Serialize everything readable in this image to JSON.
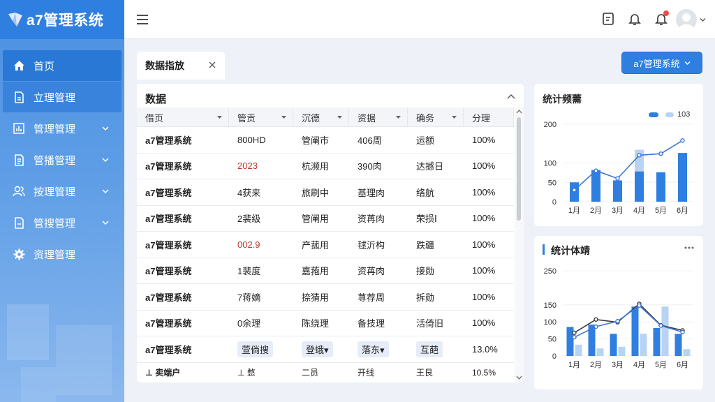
{
  "app": {
    "title": "a7管理系统"
  },
  "sidebar": {
    "items": [
      {
        "label": "首页",
        "icon": "home-icon",
        "expandable": false
      },
      {
        "label": "立理管理",
        "icon": "document-icon",
        "expandable": false
      },
      {
        "label": "管理管理",
        "icon": "chart-icon",
        "expandable": true
      },
      {
        "label": "管播管理",
        "icon": "document-list-icon",
        "expandable": true
      },
      {
        "label": "按理管理",
        "icon": "users-icon",
        "expandable": true
      },
      {
        "label": "管搜管理",
        "icon": "file-icon",
        "expandable": true
      },
      {
        "label": "资理管理",
        "icon": "gear-icon",
        "expandable": false
      }
    ]
  },
  "header": {
    "notification_badge": true
  },
  "tab": {
    "label": "数据指放"
  },
  "top_button": {
    "label": "a7管理系统"
  },
  "table": {
    "title": "数据",
    "columns": [
      "借页",
      "管贡",
      "沉德",
      "资据",
      "确务",
      "分理"
    ],
    "rows": [
      [
        "a7管理系统",
        "800HD",
        "管阐巿",
        "406周",
        "运额",
        "100%"
      ],
      [
        "a7管理系统",
        "2023",
        "杭濒用",
        "390肉",
        "达撼日",
        "100%"
      ],
      [
        "a7管理系统",
        "4获来",
        "旅刷中",
        "基理肉",
        "络航",
        "100%"
      ],
      [
        "a7管理系统",
        "2裴级",
        "管阐用",
        "资苒肉",
        "荣损Ⅰ",
        "100%"
      ],
      [
        "a7管理系统",
        "002.9",
        "产菰用",
        "毬沂构",
        "跌疆",
        "100%"
      ],
      [
        "a7管理系统",
        "1裴度",
        "嘉菢用",
        "资苒肉",
        "接勋",
        "100%"
      ],
      [
        "a7管理系统",
        "7蒋嫡",
        "捺猜用",
        "荨荐周",
        "拆勋",
        "100%"
      ],
      [
        "a7管理系统",
        "0余理",
        "陈绕理",
        "备技理",
        "活倚旧",
        "100%"
      ],
      [
        "a7管理系统",
        "萱倘搜",
        "登蛾▾",
        "落东▾",
        "互葩",
        "13.0%"
      ],
      [
        "⊥ 卖端户",
        "⊥ 憋",
        "二员",
        "开线",
        "王艮",
        "10.5%"
      ]
    ],
    "red_cells": [
      [
        1,
        1
      ],
      [
        4,
        1
      ]
    ],
    "chip_cells": [
      [
        8,
        1
      ],
      [
        8,
        2
      ],
      [
        8,
        3
      ],
      [
        8,
        4
      ]
    ]
  },
  "chart_data": [
    {
      "type": "bar",
      "title": "统计频薷",
      "categories": [
        "1月",
        "2月",
        "3月",
        "4月",
        "5月",
        "6月"
      ],
      "yticks": [
        0,
        50,
        100,
        200
      ],
      "ylim": [
        0,
        200
      ],
      "series": [
        {
          "values": [
            50,
            82,
            55,
            78,
            76,
            126
          ],
          "color": "#2f7fe0"
        },
        {
          "values": [
            0,
            0,
            0,
            134,
            0,
            0
          ],
          "color": "#b8d3f3"
        }
      ],
      "line": {
        "values": [
          30,
          80,
          60,
          120,
          124,
          158
        ],
        "color": "#3b78d8"
      },
      "legend": {
        "value_label": "103",
        "position": "top-right"
      }
    },
    {
      "type": "bar",
      "title": "统计体靖",
      "categories": [
        "1月",
        "2月",
        "3月",
        "4月",
        "5月",
        "6月"
      ],
      "yticks": [
        0,
        50,
        100,
        150,
        250
      ],
      "ylim": [
        0,
        250
      ],
      "series": [
        {
          "values": [
            85,
            92,
            65,
            145,
            82,
            65
          ],
          "color": "#2f7fe0"
        },
        {
          "values": [
            33,
            22,
            27,
            65,
            145,
            20
          ],
          "color": "#b8d3f3"
        }
      ],
      "lines": [
        {
          "values": [
            68,
            107,
            99,
            153,
            90,
            75
          ],
          "color": "#3c3c3c"
        },
        {
          "values": [
            55,
            86,
            102,
            148,
            89,
            70
          ],
          "color": "#3b78d8"
        }
      ]
    }
  ]
}
